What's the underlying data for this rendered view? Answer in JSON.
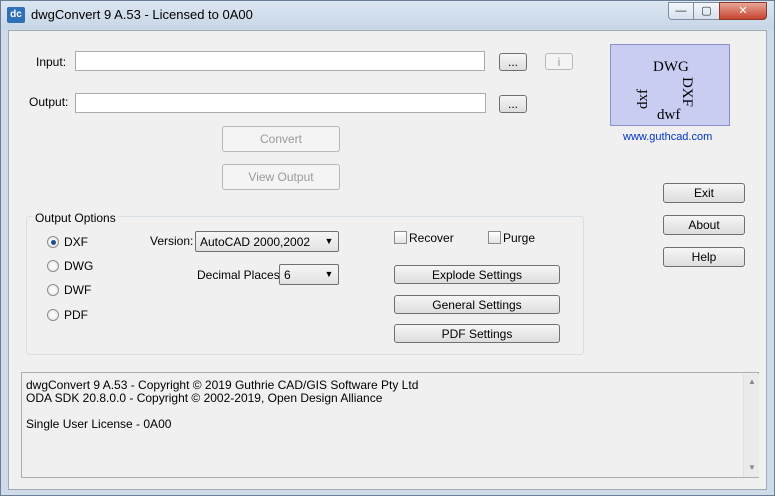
{
  "window": {
    "app_icon_text": "dc",
    "title": "dwgConvert 9 A.53 - Licensed to 0A00",
    "minimize_glyph": "—",
    "maximize_glyph": "▢",
    "close_glyph": "✕"
  },
  "io": {
    "input_label": "Input:",
    "input_value": "",
    "input_browse": "...",
    "info_button": "i",
    "output_label": "Output:",
    "output_value": "",
    "output_browse": "...",
    "convert_button": "Convert",
    "view_output_button": "View Output"
  },
  "logo": {
    "dwg": "DWG",
    "dxf_right": "DXF",
    "dxf_left": "dxf",
    "dwf": "dwf",
    "link": "www.guthcad.com"
  },
  "side_buttons": {
    "exit": "Exit",
    "about": "About",
    "help": "Help"
  },
  "output_options": {
    "title": "Output Options",
    "formats": [
      {
        "label": "DXF",
        "checked": true
      },
      {
        "label": "DWG",
        "checked": false
      },
      {
        "label": "DWF",
        "checked": false
      },
      {
        "label": "PDF",
        "checked": false
      }
    ],
    "version_label": "Version:",
    "version_value": "AutoCAD 2000,2002",
    "decimal_label": "Decimal Places:",
    "decimal_value": "6",
    "dropdown_glyph": "▼",
    "recover_label": "Recover",
    "purge_label": "Purge",
    "explode_button": "Explode Settings",
    "general_button": "General Settings",
    "pdf_button": "PDF Settings"
  },
  "info": {
    "line1": "dwgConvert 9 A.53 - Copyright © 2019 Guthrie CAD/GIS Software Pty Ltd",
    "line2": "ODA SDK 20.8.0.0 - Copyright © 2002-2019, Open Design Alliance",
    "line3": "Single User License - 0A00",
    "scroll_up_glyph": "▲",
    "scroll_down_glyph": "▼"
  }
}
